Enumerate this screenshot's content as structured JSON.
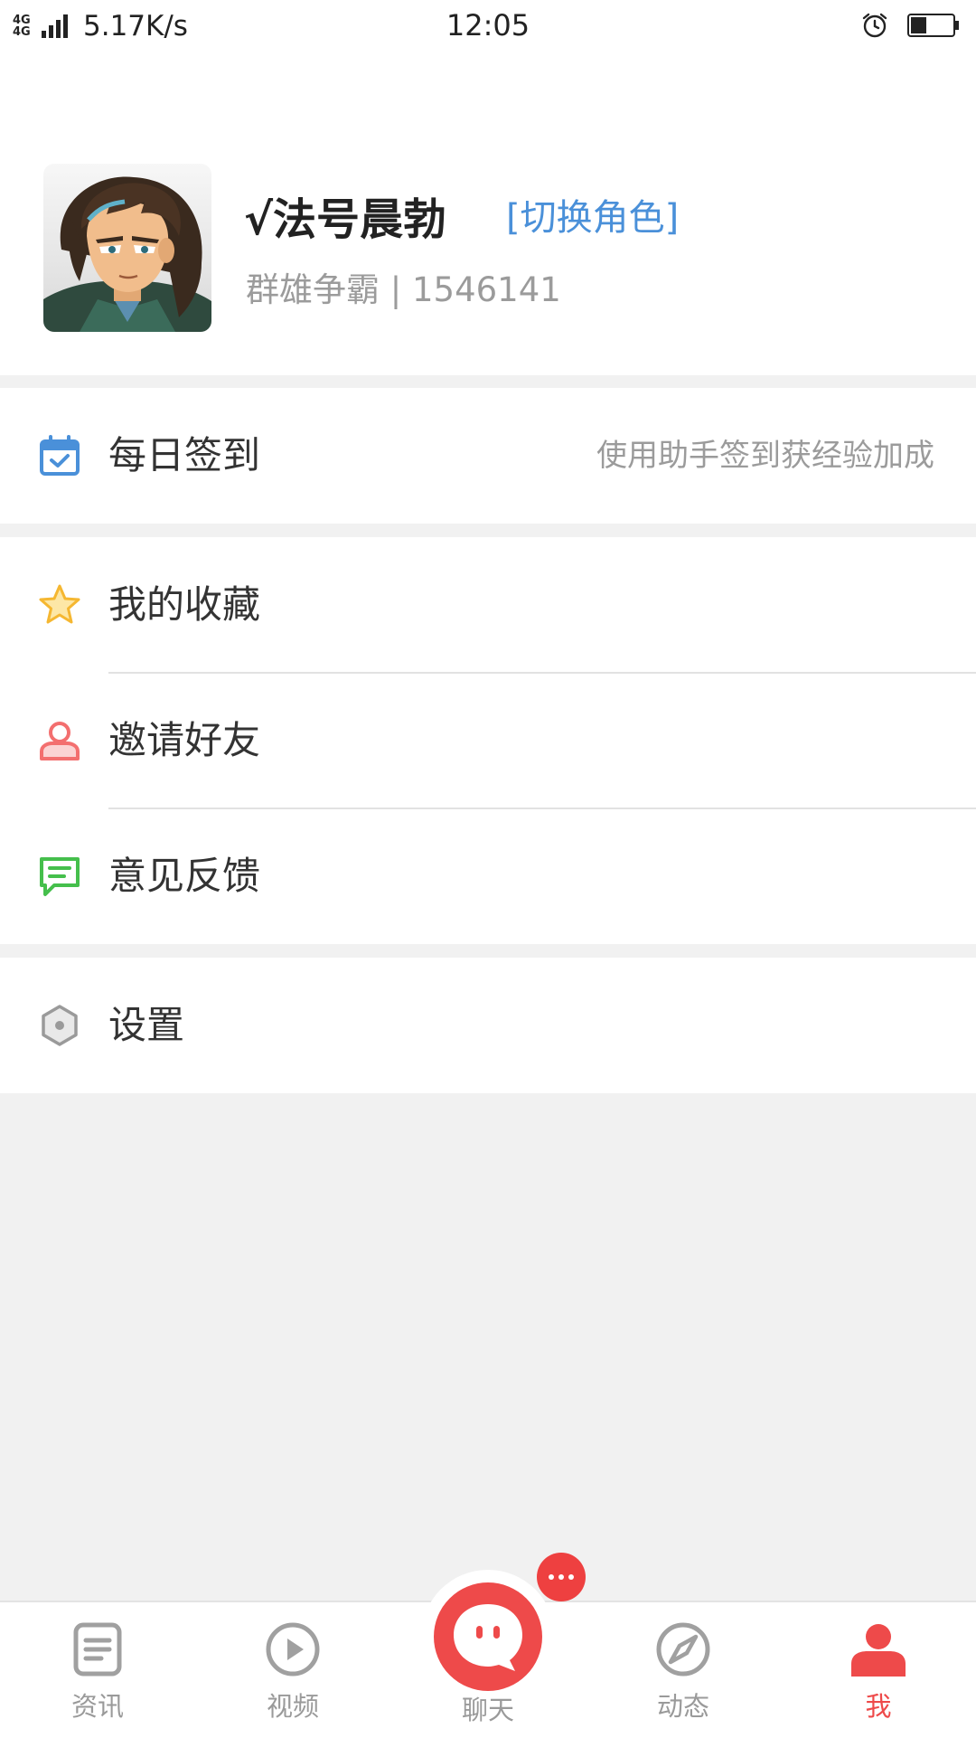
{
  "status_bar": {
    "network_type": "4G 4G",
    "net_speed": "5.17K/s",
    "time": "12:05",
    "icons": [
      "signal-icon",
      "alarm-icon",
      "battery-icon"
    ]
  },
  "profile": {
    "name": "√法号晨勃",
    "switch_role": "[切换角色]",
    "subtitle": "群雄争霸 | 1546141",
    "avatar_icon": "avatar-image"
  },
  "menu": {
    "checkin": {
      "label": "每日签到",
      "hint": "使用助手签到获经验加成",
      "icon": "calendar-check-icon",
      "icon_color": "#4a90d9"
    },
    "favorites": {
      "label": "我的收藏",
      "icon": "star-icon",
      "icon_color": "#f5b731"
    },
    "invite": {
      "label": "邀请好友",
      "icon": "user-icon",
      "icon_color": "#f36f6f"
    },
    "feedback": {
      "label": "意见反馈",
      "icon": "feedback-icon",
      "icon_color": "#45bf4c"
    },
    "settings": {
      "label": "设置",
      "icon": "settings-hex-icon",
      "icon_color": "#9a9a9a"
    }
  },
  "tab_bar": {
    "tabs": [
      {
        "label": "资讯",
        "icon": "news-icon",
        "active": false
      },
      {
        "label": "视频",
        "icon": "play-icon",
        "active": false
      },
      {
        "label": "聊天",
        "icon": "chat-icon",
        "active": false
      },
      {
        "label": "动态",
        "icon": "compass-icon",
        "active": false
      },
      {
        "label": "我",
        "icon": "profile-icon",
        "active": true
      }
    ],
    "chat_badge": "more-dots-icon"
  },
  "colors": {
    "accent": "#ee4a4a",
    "link": "#4a90d9",
    "background": "#f1f1f1"
  }
}
